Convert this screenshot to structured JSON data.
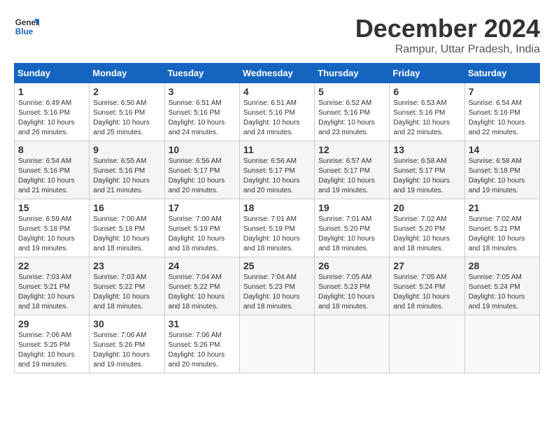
{
  "logo": {
    "line1": "General",
    "line2": "Blue"
  },
  "title": "December 2024",
  "subtitle": "Rampur, Uttar Pradesh, India",
  "days_of_week": [
    "Sunday",
    "Monday",
    "Tuesday",
    "Wednesday",
    "Thursday",
    "Friday",
    "Saturday"
  ],
  "weeks": [
    [
      {
        "day": "1",
        "info": "Sunrise: 6:49 AM\nSunset: 5:16 PM\nDaylight: 10 hours\nand 26 minutes."
      },
      {
        "day": "2",
        "info": "Sunrise: 6:50 AM\nSunset: 5:16 PM\nDaylight: 10 hours\nand 25 minutes."
      },
      {
        "day": "3",
        "info": "Sunrise: 6:51 AM\nSunset: 5:16 PM\nDaylight: 10 hours\nand 24 minutes."
      },
      {
        "day": "4",
        "info": "Sunrise: 6:51 AM\nSunset: 5:16 PM\nDaylight: 10 hours\nand 24 minutes."
      },
      {
        "day": "5",
        "info": "Sunrise: 6:52 AM\nSunset: 5:16 PM\nDaylight: 10 hours\nand 23 minutes."
      },
      {
        "day": "6",
        "info": "Sunrise: 6:53 AM\nSunset: 5:16 PM\nDaylight: 10 hours\nand 22 minutes."
      },
      {
        "day": "7",
        "info": "Sunrise: 6:54 AM\nSunset: 5:16 PM\nDaylight: 10 hours\nand 22 minutes."
      }
    ],
    [
      {
        "day": "8",
        "info": "Sunrise: 6:54 AM\nSunset: 5:16 PM\nDaylight: 10 hours\nand 21 minutes."
      },
      {
        "day": "9",
        "info": "Sunrise: 6:55 AM\nSunset: 5:16 PM\nDaylight: 10 hours\nand 21 minutes."
      },
      {
        "day": "10",
        "info": "Sunrise: 6:56 AM\nSunset: 5:17 PM\nDaylight: 10 hours\nand 20 minutes."
      },
      {
        "day": "11",
        "info": "Sunrise: 6:56 AM\nSunset: 5:17 PM\nDaylight: 10 hours\nand 20 minutes."
      },
      {
        "day": "12",
        "info": "Sunrise: 6:57 AM\nSunset: 5:17 PM\nDaylight: 10 hours\nand 19 minutes."
      },
      {
        "day": "13",
        "info": "Sunrise: 6:58 AM\nSunset: 5:17 PM\nDaylight: 10 hours\nand 19 minutes."
      },
      {
        "day": "14",
        "info": "Sunrise: 6:58 AM\nSunset: 5:18 PM\nDaylight: 10 hours\nand 19 minutes."
      }
    ],
    [
      {
        "day": "15",
        "info": "Sunrise: 6:59 AM\nSunset: 5:18 PM\nDaylight: 10 hours\nand 19 minutes."
      },
      {
        "day": "16",
        "info": "Sunrise: 7:00 AM\nSunset: 5:18 PM\nDaylight: 10 hours\nand 18 minutes."
      },
      {
        "day": "17",
        "info": "Sunrise: 7:00 AM\nSunset: 5:19 PM\nDaylight: 10 hours\nand 18 minutes."
      },
      {
        "day": "18",
        "info": "Sunrise: 7:01 AM\nSunset: 5:19 PM\nDaylight: 10 hours\nand 18 minutes."
      },
      {
        "day": "19",
        "info": "Sunrise: 7:01 AM\nSunset: 5:20 PM\nDaylight: 10 hours\nand 18 minutes."
      },
      {
        "day": "20",
        "info": "Sunrise: 7:02 AM\nSunset: 5:20 PM\nDaylight: 10 hours\nand 18 minutes."
      },
      {
        "day": "21",
        "info": "Sunrise: 7:02 AM\nSunset: 5:21 PM\nDaylight: 10 hours\nand 18 minutes."
      }
    ],
    [
      {
        "day": "22",
        "info": "Sunrise: 7:03 AM\nSunset: 5:21 PM\nDaylight: 10 hours\nand 18 minutes."
      },
      {
        "day": "23",
        "info": "Sunrise: 7:03 AM\nSunset: 5:22 PM\nDaylight: 10 hours\nand 18 minutes."
      },
      {
        "day": "24",
        "info": "Sunrise: 7:04 AM\nSunset: 5:22 PM\nDaylight: 10 hours\nand 18 minutes."
      },
      {
        "day": "25",
        "info": "Sunrise: 7:04 AM\nSunset: 5:23 PM\nDaylight: 10 hours\nand 18 minutes."
      },
      {
        "day": "26",
        "info": "Sunrise: 7:05 AM\nSunset: 5:23 PM\nDaylight: 10 hours\nand 18 minutes."
      },
      {
        "day": "27",
        "info": "Sunrise: 7:05 AM\nSunset: 5:24 PM\nDaylight: 10 hours\nand 18 minutes."
      },
      {
        "day": "28",
        "info": "Sunrise: 7:05 AM\nSunset: 5:24 PM\nDaylight: 10 hours\nand 19 minutes."
      }
    ],
    [
      {
        "day": "29",
        "info": "Sunrise: 7:06 AM\nSunset: 5:25 PM\nDaylight: 10 hours\nand 19 minutes."
      },
      {
        "day": "30",
        "info": "Sunrise: 7:06 AM\nSunset: 5:26 PM\nDaylight: 10 hours\nand 19 minutes."
      },
      {
        "day": "31",
        "info": "Sunrise: 7:06 AM\nSunset: 5:26 PM\nDaylight: 10 hours\nand 20 minutes."
      },
      {
        "day": "",
        "info": ""
      },
      {
        "day": "",
        "info": ""
      },
      {
        "day": "",
        "info": ""
      },
      {
        "day": "",
        "info": ""
      }
    ]
  ]
}
